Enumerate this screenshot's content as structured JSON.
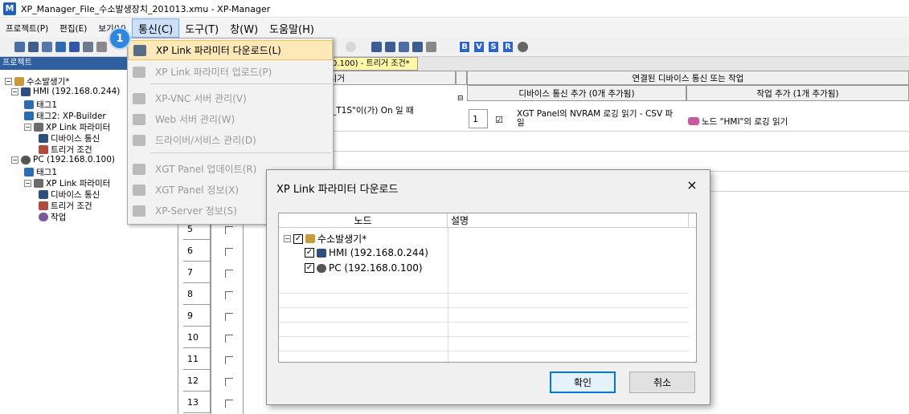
{
  "window": {
    "title": "XP_Manager_File_수소발생장치_201013.xmu - XP-Manager",
    "app_icon_letter": "M"
  },
  "menubar": {
    "items": [
      "프로젝트(P)",
      "편집(E)",
      "보기(V)",
      "통신(C)",
      "도구(T)",
      "창(W)",
      "도움말(H)"
    ]
  },
  "toolbar": {
    "letter_buttons": [
      "B",
      "V",
      "S",
      "R"
    ]
  },
  "project_panel": {
    "title": "프로젝트",
    "tree": [
      "수소발생기*",
      "HMI (192.168.0.244)",
      "태그1",
      "태그2: XP-Builder",
      "XP Link 파라미터",
      "디바이스 통신",
      "트리거 조건",
      "PC (192.168.0.100)",
      "태그1",
      "XP Link 파라미터",
      "디바이스 통신",
      "트리거 조건",
      "작업"
    ]
  },
  "tab": {
    "active_label": "0.100) - 트리거 조건*"
  },
  "grid": {
    "header_trigger": "트리거",
    "header_linked": "연결된 디바이스 통신 또는 작업",
    "header_device_add": "디바이스 통신 추가 (0개 추가됨)",
    "header_job_add": "작업 추가 (1개 추가됨)",
    "trigger_text": "_T1S\"이(가) On 일 때",
    "device_row_num": "1",
    "device_text": "XGT Panel의 NVRAM 로깅 읽기 - CSV 파일",
    "job_text": "노드 \"HMI\"의 로깅 읽기",
    "row_numbers": [
      "5",
      "6",
      "7",
      "8",
      "9",
      "10",
      "11",
      "12",
      "13"
    ]
  },
  "badge": {
    "label": "1"
  },
  "dropdown": {
    "items": [
      {
        "label": "XP Link 파라미터 다운로드(L)",
        "enabled": true
      },
      {
        "label": "XP Link 파라미터 업로드(P)",
        "enabled": false
      },
      {
        "label": "XP-VNC 서버 관리(V)",
        "enabled": false
      },
      {
        "label": "Web 서버 관리(W)",
        "enabled": false
      },
      {
        "label": "드라이버/서비스 관리(D)",
        "enabled": false
      },
      {
        "label": "XGT Panel 업데이트(R)",
        "enabled": false
      },
      {
        "label": "XGT Panel 정보(X)",
        "enabled": false
      },
      {
        "label": "XP-Server 정보(S)",
        "enabled": false
      }
    ]
  },
  "dialog": {
    "title": "XP Link 파라미터 다운로드",
    "col_node": "노드",
    "col_desc": "설명",
    "tree": [
      "수소발생기*",
      "HMI (192.168.0.244)",
      "PC (192.168.0.100)"
    ],
    "ok_label": "확인",
    "cancel_label": "취소",
    "close_glyph": "×"
  },
  "colors": {
    "accent": "#0078d7",
    "panel_header": "#2f5f9e",
    "highlight": "#fde9b8",
    "tab_active": "#fff6a8"
  }
}
